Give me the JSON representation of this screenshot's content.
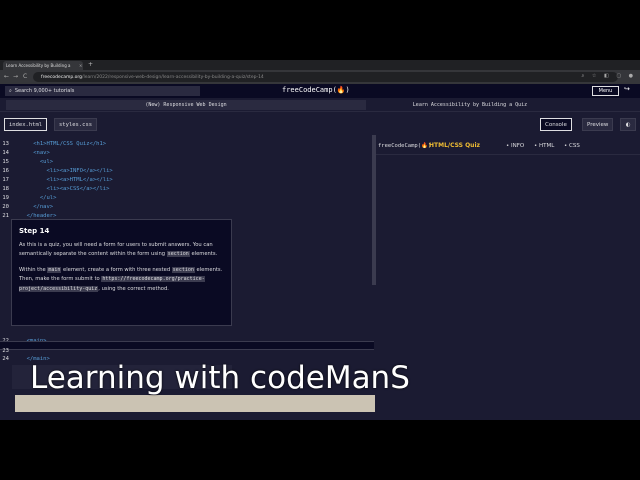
{
  "browser": {
    "tab_title": "Learn Accessibility by Building a",
    "tab_close": "×",
    "new_tab": "+",
    "url_host": "freecodecamp.org",
    "url_path": "/learn/2022/responsive-web-design/learn-accessibility-by-building-a-quiz/step-14",
    "nav_back": "←",
    "nav_forward": "→",
    "nav_reload": "C",
    "ext_icons": "⌕ ☆ ◧ ▢ ●"
  },
  "fcc": {
    "search_icon": "⌕",
    "search_placeholder": "Search 9,000+ tutorials",
    "logo": "freeCodeCamp(🔥)",
    "menu_label": "Menu",
    "exit_icon": "↪"
  },
  "breadcrumb": {
    "course": "(New) Responsive Web Design",
    "project": "Learn Accessibility by Building a Quiz"
  },
  "editor_tabs": {
    "files": [
      "index.html",
      "styles.css"
    ],
    "console_label": "Console",
    "preview_label": "Preview",
    "toggle_icon": "◐"
  },
  "code_top": [
    {
      "ln": "13",
      "code": "    <h1>HTML/CSS Quiz</h1>"
    },
    {
      "ln": "14",
      "code": "    <nav>"
    },
    {
      "ln": "15",
      "code": "      <ul>"
    },
    {
      "ln": "16",
      "code": "        <li><a>INFO</a></li>"
    },
    {
      "ln": "17",
      "code": "        <li><a>HTML</a></li>"
    },
    {
      "ln": "18",
      "code": "        <li><a>CSS</a></li>"
    },
    {
      "ln": "19",
      "code": "      </ul>"
    },
    {
      "ln": "20",
      "code": "    </nav>"
    },
    {
      "ln": "21",
      "code": "  </header>"
    }
  ],
  "code_bottom": [
    {
      "ln": "22",
      "code": "  <main>"
    },
    {
      "ln": "23",
      "code": ""
    },
    {
      "ln": "24",
      "code": "  </main>"
    }
  ],
  "step": {
    "title": "Step 14",
    "p1_a": "As this is a quiz, you will need a form for users to submit answers. You can semantically separate the content within the form using",
    "p1_code": "section",
    "p1_b": "elements.",
    "p2_a": "Within the",
    "p2_code1": "main",
    "p2_b": "element, create a form with three nested",
    "p2_code2": "section",
    "p2_c": "elements. Then, make the form submit to",
    "p2_code3": "https://freecodecamp.org/practice-project/accessibility-quiz",
    "p2_d": ", using the correct method."
  },
  "preview": {
    "logo": "freeCodeCamp(🔥)",
    "title": "HTML/CSS Quiz",
    "nav": [
      "• INFO",
      "• HTML",
      "• CSS"
    ]
  },
  "caption": "Learning with codeManS"
}
